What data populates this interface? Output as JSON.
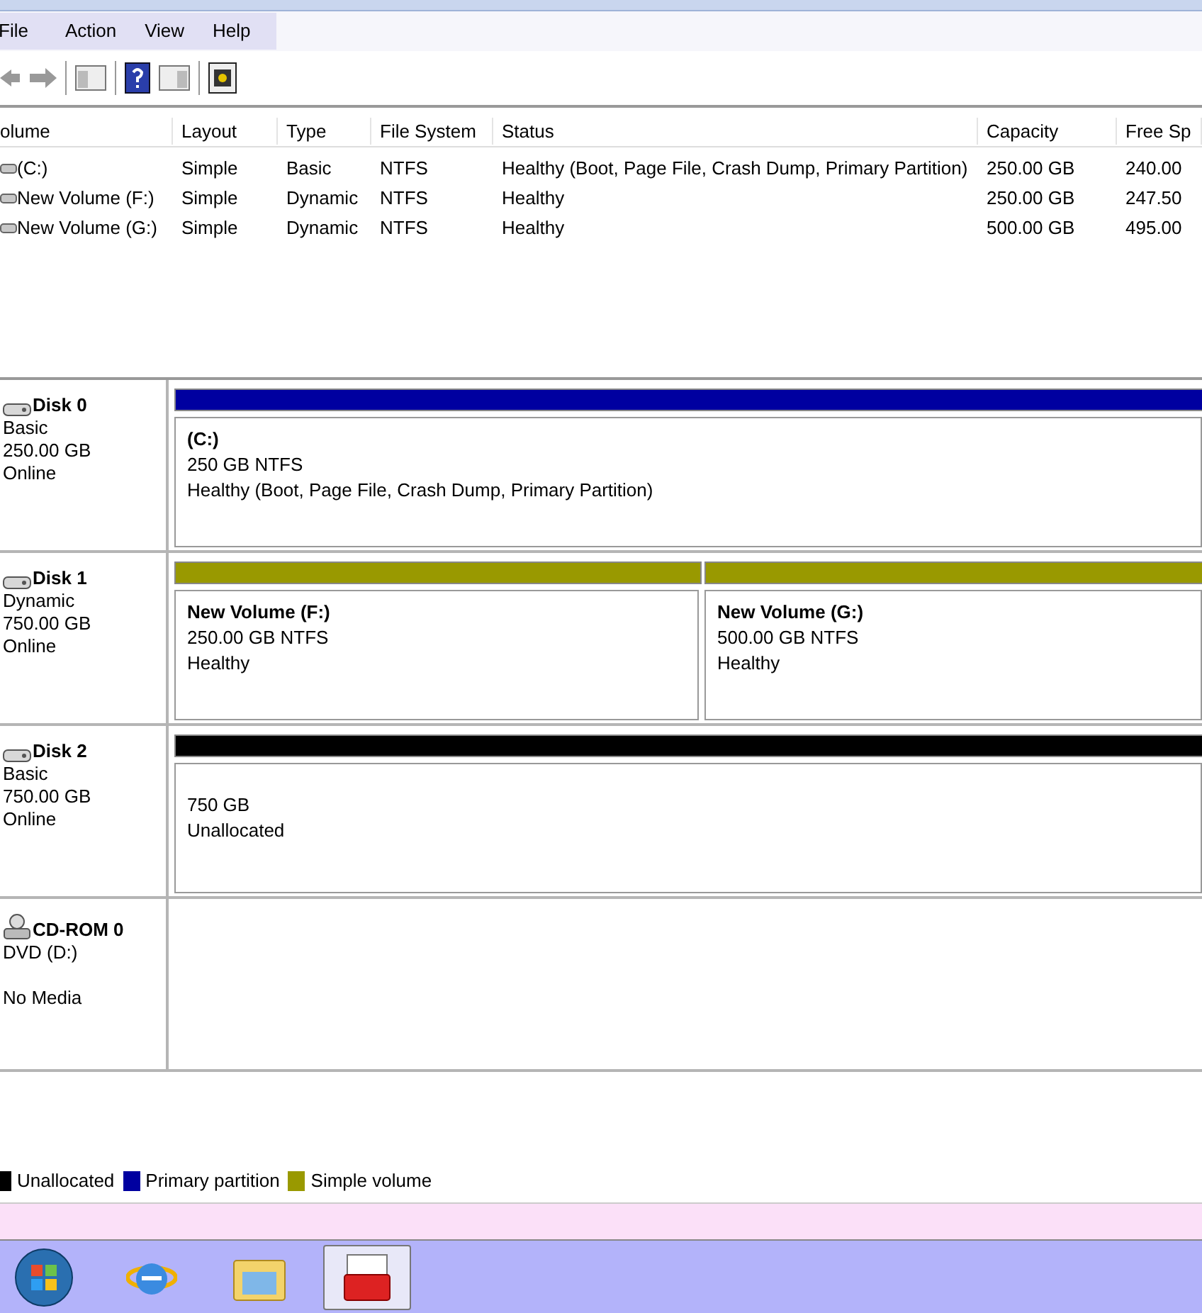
{
  "menu": [
    "File",
    "Action",
    "View",
    "Help"
  ],
  "table": {
    "columns": [
      "olume",
      "Layout",
      "Type",
      "File System",
      "Status",
      "Capacity",
      "Free Sp"
    ],
    "rows": [
      {
        "cells": [
          "(C:)",
          "Simple",
          "Basic",
          "NTFS",
          "Healthy (Boot, Page File, Crash Dump, Primary Partition)",
          "250.00 GB",
          "240.00"
        ]
      },
      {
        "cells": [
          "New Volume (F:)",
          "Simple",
          "Dynamic",
          "NTFS",
          "Healthy",
          "250.00 GB",
          "247.50"
        ]
      },
      {
        "cells": [
          "New Volume (G:)",
          "Simple",
          "Dynamic",
          "NTFS",
          "Healthy",
          "500.00 GB",
          "495.00"
        ]
      }
    ]
  },
  "disks": [
    {
      "kind": "disk",
      "name": "Disk 0",
      "lines": [
        "Basic",
        "250.00 GB",
        "Online"
      ],
      "volumes": [
        {
          "title": "(C:)",
          "lines": [
            "250 GB NTFS",
            "Healthy (Boot, Page File, Crash Dump, Primary Partition)"
          ],
          "color": "#0000a0"
        }
      ]
    },
    {
      "kind": "disk",
      "name": "Disk 1",
      "lines": [
        "Dynamic",
        "750.00 GB",
        "Online"
      ],
      "volumes": [
        {
          "title": "New Volume (F:)",
          "lines": [
            "250.00 GB NTFS",
            "Healthy"
          ],
          "color": "#999900"
        },
        {
          "title": "New Volume (G:)",
          "lines": [
            "500.00 GB NTFS",
            "Healthy"
          ],
          "color": "#999900"
        }
      ]
    },
    {
      "kind": "disk",
      "name": "Disk 2",
      "lines": [
        "Basic",
        "750.00 GB",
        "Online"
      ],
      "volumes": [
        {
          "lines": [
            "750 GB",
            "Unallocated"
          ],
          "color": "#000000"
        }
      ]
    },
    {
      "kind": "cdrom",
      "name": "CD-ROM 0",
      "lines": [
        "DVD (D:)",
        "No Media"
      ]
    }
  ],
  "legend": [
    {
      "label": "Unallocated",
      "color": "#000000"
    },
    {
      "label": "Primary partition",
      "color": "#0000a0"
    },
    {
      "label": "Simple volume",
      "color": "#999900"
    }
  ],
  "taskbar": [
    {
      "kind": "start",
      "selected": false
    },
    {
      "kind": "browser",
      "selected": false
    },
    {
      "kind": "folder",
      "selected": false
    },
    {
      "kind": "toolbox",
      "selected": true
    }
  ]
}
